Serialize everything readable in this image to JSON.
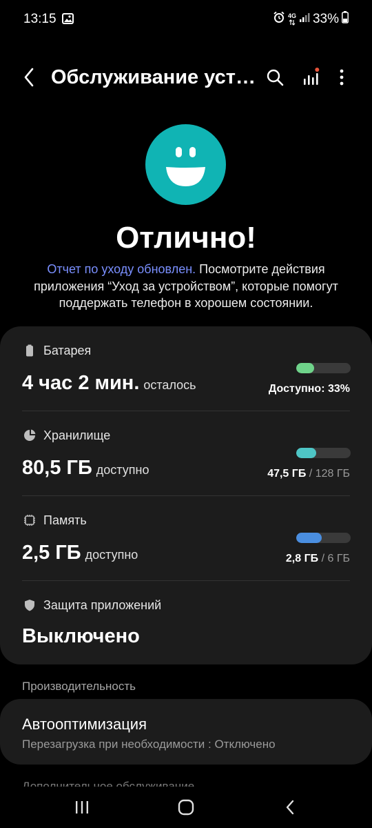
{
  "status_bar": {
    "time": "13:15",
    "network": "4G",
    "battery": "33%"
  },
  "app_bar": {
    "title": "Обслуживание устройства"
  },
  "hero": {
    "status": "Отлично!",
    "link_text": "Отчет по уходу обновлен.",
    "description": " Посмотрите действия приложения “Уход за устройством”, которые помогут поддержать телефон в хорошем состоянии."
  },
  "battery": {
    "label": "Батарея",
    "value": "4 час 2 мин.",
    "suffix": "осталось",
    "right": "Доступно: 33%",
    "fill": 0.33,
    "color": "#6fd38a"
  },
  "storage": {
    "label": "Хранилище",
    "value": "80,5 ГБ",
    "suffix": "доступно",
    "used": "47,5 ГБ",
    "total": "/ 128 ГБ",
    "fill": 0.371,
    "color": "#4ec6c6"
  },
  "memory": {
    "label": "Память",
    "value": "2,5 ГБ",
    "suffix": "доступно",
    "used": "2,8 ГБ",
    "total": "/ 6 ГБ",
    "fill": 0.47,
    "color": "#4a8ee0"
  },
  "app_protection": {
    "label": "Защита приложений",
    "value": "Выключено"
  },
  "performance": {
    "header": "Производительность",
    "title": "Автооптимизация",
    "subtitle": "Перезагрузка при необходимости : Отключено"
  },
  "next_section": {
    "header": "Дополнительное обслуживание"
  },
  "colors": {
    "accent_link": "#7a8fff",
    "smiley": "#10b4b4",
    "notification_dot": "#e8543a"
  }
}
